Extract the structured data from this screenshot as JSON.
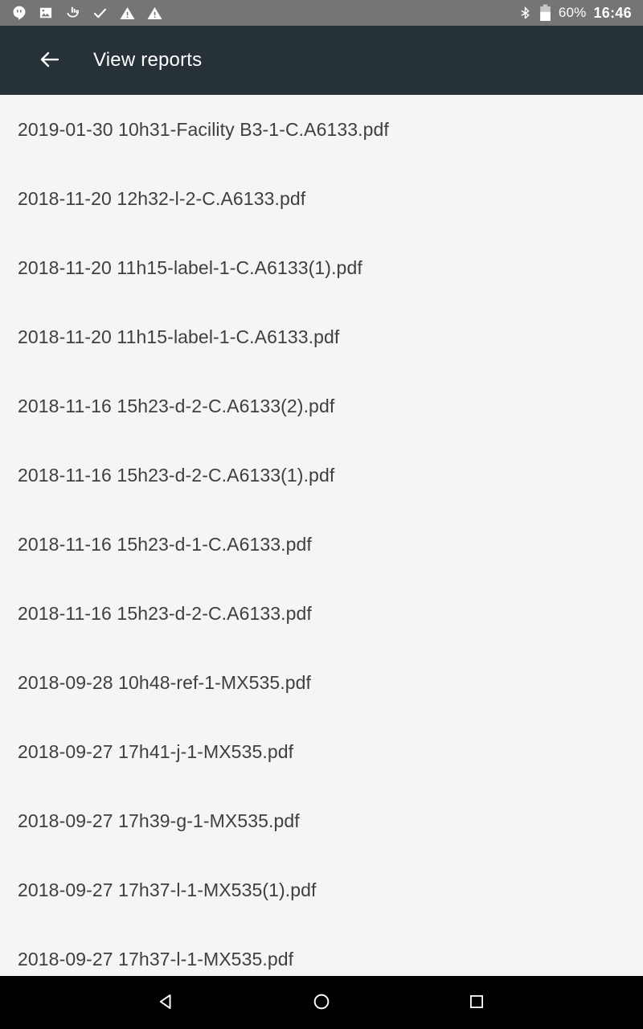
{
  "status_bar": {
    "background_color": "#757575",
    "left_icons": [
      {
        "name": "hangouts-icon",
        "label": "Hangouts"
      },
      {
        "name": "image-icon",
        "label": "Screenshot"
      },
      {
        "name": "tap-and-pay-icon",
        "label": "Tap"
      },
      {
        "name": "check-icon",
        "label": "Done"
      },
      {
        "name": "warning-icon",
        "label": "Warning"
      },
      {
        "name": "warning-icon-2",
        "label": "Warning"
      }
    ],
    "bluetooth_icon": "bluetooth-icon",
    "battery_icon": "battery-icon",
    "battery_percent": "60%",
    "clock": "16:46"
  },
  "app_bar": {
    "background_color": "#263238",
    "back_icon": "arrow-left-icon",
    "title": "View reports"
  },
  "list": {
    "background_color": "#f5f5f5",
    "text_color": "#3c4043",
    "items": [
      {
        "filename": "2019-01-30 10h31-Facility B3-1-C.A6133.pdf"
      },
      {
        "filename": "2018-11-20 12h32-l-2-C.A6133.pdf"
      },
      {
        "filename": "2018-11-20 11h15-label-1-C.A6133(1).pdf"
      },
      {
        "filename": "2018-11-20 11h15-label-1-C.A6133.pdf"
      },
      {
        "filename": "2018-11-16 15h23-d-2-C.A6133(2).pdf"
      },
      {
        "filename": "2018-11-16 15h23-d-2-C.A6133(1).pdf"
      },
      {
        "filename": "2018-11-16 15h23-d-1-C.A6133.pdf"
      },
      {
        "filename": "2018-11-16 15h23-d-2-C.A6133.pdf"
      },
      {
        "filename": "2018-09-28 10h48-ref-1-MX535.pdf"
      },
      {
        "filename": "2018-09-27 17h41-j-1-MX535.pdf"
      },
      {
        "filename": "2018-09-27 17h39-g-1-MX535.pdf"
      },
      {
        "filename": "2018-09-27 17h37-l-1-MX535(1).pdf"
      },
      {
        "filename": "2018-09-27 17h37-l-1-MX535.pdf"
      }
    ]
  },
  "nav_bar": {
    "background_color": "#000000",
    "buttons": [
      {
        "name": "back-nav-button",
        "label": "Back"
      },
      {
        "name": "home-nav-button",
        "label": "Home"
      },
      {
        "name": "recents-nav-button",
        "label": "Recents"
      }
    ]
  }
}
